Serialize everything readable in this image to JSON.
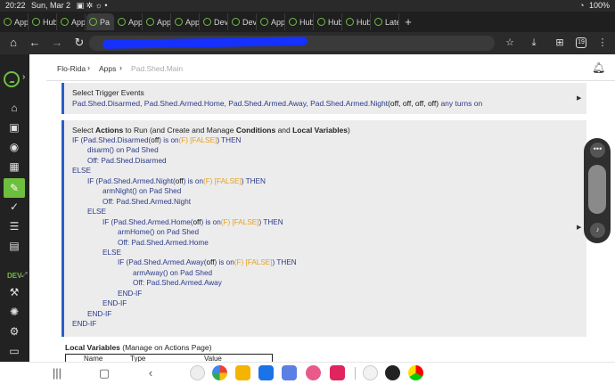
{
  "status_bar": {
    "time": "20:22",
    "date": "Sun, Mar 2",
    "battery": "100%"
  },
  "tabs": [
    {
      "label": "Apps",
      "active": false
    },
    {
      "label": "Hub",
      "active": false
    },
    {
      "label": "Apps",
      "active": false
    },
    {
      "label": "Pa",
      "active": true
    },
    {
      "label": "Apps",
      "active": false
    },
    {
      "label": "Apps",
      "active": false
    },
    {
      "label": "Apps",
      "active": false
    },
    {
      "label": "Devi",
      "active": false
    },
    {
      "label": "Devi",
      "active": false
    },
    {
      "label": "Apps",
      "active": false
    },
    {
      "label": "Hub",
      "active": false
    },
    {
      "label": "Hub",
      "active": false
    },
    {
      "label": "Hub",
      "active": false
    },
    {
      "label": "Late",
      "active": false
    }
  ],
  "toolbar": {
    "tab_count": "19"
  },
  "breadcrumb": {
    "root": "Flo-Rida",
    "apps": "Apps",
    "current": "Pad.Shed.Main"
  },
  "trigger": {
    "heading": "Select Trigger Events",
    "devices": "Pad.Shed.Disarmed, Pad.Shed.Armed.Home, Pad.Shed.Armed.Away, Pad.Shed.Armed.Night",
    "states": "(off, off, off, off)",
    "suffix": " any turns on"
  },
  "actions": {
    "heading_prefix": "Select ",
    "heading_bold1": "Actions",
    "heading_mid1": " to Run (and Create and Manage ",
    "heading_bold2": "Conditions",
    "heading_mid2": " and ",
    "heading_bold3": "Local Variables",
    "heading_suffix": ")",
    "lines": [
      {
        "indent": 0,
        "parts": [
          {
            "t": "IF (Pad.Shed.Disarmed(",
            "c": "kw"
          },
          {
            "t": "off",
            "c": "bk"
          },
          {
            "t": ") is on",
            "c": "kw"
          },
          {
            "t": "(F) [FALSE]",
            "c": "or"
          },
          {
            "t": ") THEN",
            "c": "kw"
          }
        ]
      },
      {
        "indent": 1,
        "parts": [
          {
            "t": "disarm() on Pad Shed",
            "c": "ok"
          }
        ]
      },
      {
        "indent": 1,
        "parts": [
          {
            "t": "Off: Pad.Shed.Disarmed",
            "c": "ok"
          }
        ]
      },
      {
        "indent": 0,
        "parts": [
          {
            "t": "ELSE",
            "c": "kw"
          }
        ]
      },
      {
        "indent": 1,
        "parts": [
          {
            "t": "IF (Pad.Shed.Armed.Night(",
            "c": "kw"
          },
          {
            "t": "off",
            "c": "bk"
          },
          {
            "t": ") is on",
            "c": "kw"
          },
          {
            "t": "(F) [FALSE]",
            "c": "or"
          },
          {
            "t": ") THEN",
            "c": "kw"
          }
        ]
      },
      {
        "indent": 2,
        "parts": [
          {
            "t": "armNight() on Pad Shed",
            "c": "ok"
          }
        ]
      },
      {
        "indent": 2,
        "parts": [
          {
            "t": "Off: Pad.Shed.Armed.Night",
            "c": "ok"
          }
        ]
      },
      {
        "indent": 1,
        "parts": [
          {
            "t": "ELSE",
            "c": "kw"
          }
        ]
      },
      {
        "indent": 2,
        "parts": [
          {
            "t": "IF (Pad.Shed.Armed.Home(",
            "c": "kw"
          },
          {
            "t": "off",
            "c": "bk"
          },
          {
            "t": ") is on",
            "c": "kw"
          },
          {
            "t": "(F) [FALSE]",
            "c": "or"
          },
          {
            "t": ") THEN",
            "c": "kw"
          }
        ]
      },
      {
        "indent": 3,
        "parts": [
          {
            "t": "armHome() on Pad Shed",
            "c": "ok"
          }
        ]
      },
      {
        "indent": 3,
        "parts": [
          {
            "t": "Off: Pad.Shed.Armed.Home",
            "c": "ok"
          }
        ]
      },
      {
        "indent": 2,
        "parts": [
          {
            "t": "ELSE",
            "c": "kw"
          }
        ]
      },
      {
        "indent": 3,
        "parts": [
          {
            "t": "IF (Pad.Shed.Armed.Away(",
            "c": "kw"
          },
          {
            "t": "off",
            "c": "bk"
          },
          {
            "t": ") is on",
            "c": "kw"
          },
          {
            "t": "(F) [FALSE]",
            "c": "or"
          },
          {
            "t": ") THEN",
            "c": "kw"
          }
        ]
      },
      {
        "indent": 4,
        "parts": [
          {
            "t": "armAway() on Pad Shed",
            "c": "ok"
          }
        ]
      },
      {
        "indent": 4,
        "parts": [
          {
            "t": "Off: Pad.Shed.Armed.Away",
            "c": "ok"
          }
        ]
      },
      {
        "indent": 3,
        "parts": [
          {
            "t": "END-IF",
            "c": "kw"
          }
        ]
      },
      {
        "indent": 2,
        "parts": [
          {
            "t": "END-IF",
            "c": "kw"
          }
        ]
      },
      {
        "indent": 1,
        "parts": [
          {
            "t": "END-IF",
            "c": "kw"
          }
        ]
      },
      {
        "indent": 0,
        "parts": [
          {
            "t": "END-IF",
            "c": "kw"
          }
        ]
      }
    ]
  },
  "local_vars": {
    "label": "Local Variables",
    "note": " (Manage on Actions Page)",
    "columns": [
      "Name",
      "Type",
      "Value"
    ]
  },
  "sidebar": {
    "dev_label": "DEV"
  },
  "colors": {
    "accent_green": "#6fbf3f",
    "card_border": "#2a5ec6",
    "text_blue": "#2b3a8a",
    "false_orange": "#e6a020"
  }
}
